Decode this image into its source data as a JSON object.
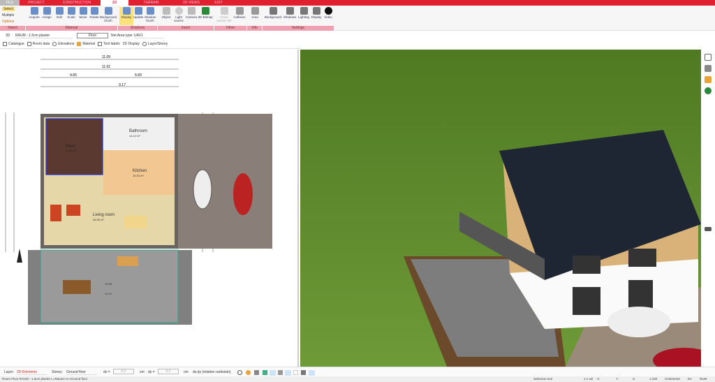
{
  "tabs": [
    "FILE",
    "PROJECT",
    "CONSTRUCTION",
    "3D",
    "TERRAIN",
    "2D VIEWS",
    "EDIT"
  ],
  "ribbon": {
    "select": {
      "select": "Select",
      "multiple": "Multiple",
      "options": "Options",
      "label": "Select"
    },
    "material": {
      "buttons": [
        "Acquire",
        "Assign",
        "Edit",
        "Scale",
        "Move",
        "Rotate",
        "Background brush"
      ],
      "label": "Material"
    },
    "shadows": {
      "buttons": [
        "Display",
        "Update",
        "Shadow brush"
      ],
      "label": "Shadows"
    },
    "insert": {
      "buttons": [
        "Object",
        "Light source",
        "Camera",
        "3D-Bitmap"
      ],
      "label": "Insert"
    },
    "other": {
      "buttons": [
        "Cross section 3D",
        "Collision"
      ],
      "label": "Other"
    },
    "info": {
      "buttons": [
        "Area"
      ],
      "label": "Info"
    },
    "settings": {
      "buttons": [
        "Background",
        "Shadows",
        "Lighting",
        "Display",
        "Video"
      ],
      "label": "Settings"
    }
  },
  "props": {
    "mode": "3D",
    "material": "RAUM - 1.5cm plaster",
    "floor": "Floor",
    "net_area_label": "Net Area type:",
    "net_area": "UAV1"
  },
  "toolbar2": [
    "Catalogue",
    "Room data",
    "Elevations",
    "Material",
    "Text labels",
    "2D Display",
    "Layer/Storey"
  ],
  "plan": {
    "rooms": [
      {
        "name": "Bathroom",
        "area": "14.12 m²"
      },
      {
        "name": "Kitchen",
        "area": "19.20 m²"
      },
      {
        "name": "Living room",
        "area": "46.95 m²"
      },
      {
        "name": "Floor",
        "area": "14.34 m²"
      }
    ],
    "dims": [
      "11.09",
      "11.01",
      "4.65",
      "5.60",
      "9.17",
      "10.56",
      "11.09"
    ]
  },
  "bottom": {
    "layer_label": "Layer:",
    "layer": "2D-Elements",
    "storey_label": "Storey:",
    "storey": "Ground floor",
    "dx_label": "dx =",
    "dx": "0.0",
    "dy_label": "dy =",
    "dy": "0.0",
    "unit": "cm",
    "coord_mode": "dx,dy (relative cartesian)"
  },
  "status": {
    "left": "Room Floor RAUM - 1.5cm plaster L=Räume G=Ground floor",
    "tool": "Selection tool",
    "sel": "1:1 sel",
    "x": "X:",
    "y": "Y:",
    "z": "Z:",
    "scale": "1:100",
    "units": "Centimetre",
    "language": "En",
    "num": "NUM"
  },
  "colors": {
    "accent": "#e0202e",
    "ribbon_group": "#f0a0b0",
    "grass": "#5e8a2a",
    "roof": "#1e2633"
  }
}
